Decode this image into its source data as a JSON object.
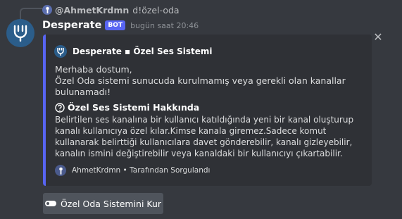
{
  "reply": {
    "author": "@AhmetKrdmn",
    "command": "d!özel-oda"
  },
  "message": {
    "username": "Desperate",
    "bot_tag": "BOT",
    "timestamp": "bugün saat 20:46"
  },
  "embed": {
    "accent_color": "#5865f2",
    "author": "Desperate ▪ Özel Ses Sistemi",
    "description_line1": "Merhaba dostum,",
    "description_line2": "Özel Oda sistemi sunucuda kurulmamış veya gerekli olan kanallar bulunamadı!",
    "field_name": "Özel Ses Sistemi Hakkında",
    "field_value": "Belirtilen ses kanalına bir kullanıcı katıldığında yeni bir kanal oluşturup kanalı kullanıcıya özel kılar.Kimse kanala giremez.Sadece komut kullanarak belirttiği kullanıcılara davet gönderebilir, kanalı gizleyebilir, kanalın ismini değiştirebilir veya kanaldaki bir kullanıcıyı çıkartabilir.",
    "footer": "AhmetKrdmn • Tarafından Sorgulandı"
  },
  "button": {
    "label": "Özel Oda Sistemini Kur",
    "icon": "toggle-icon"
  },
  "close": "✕"
}
